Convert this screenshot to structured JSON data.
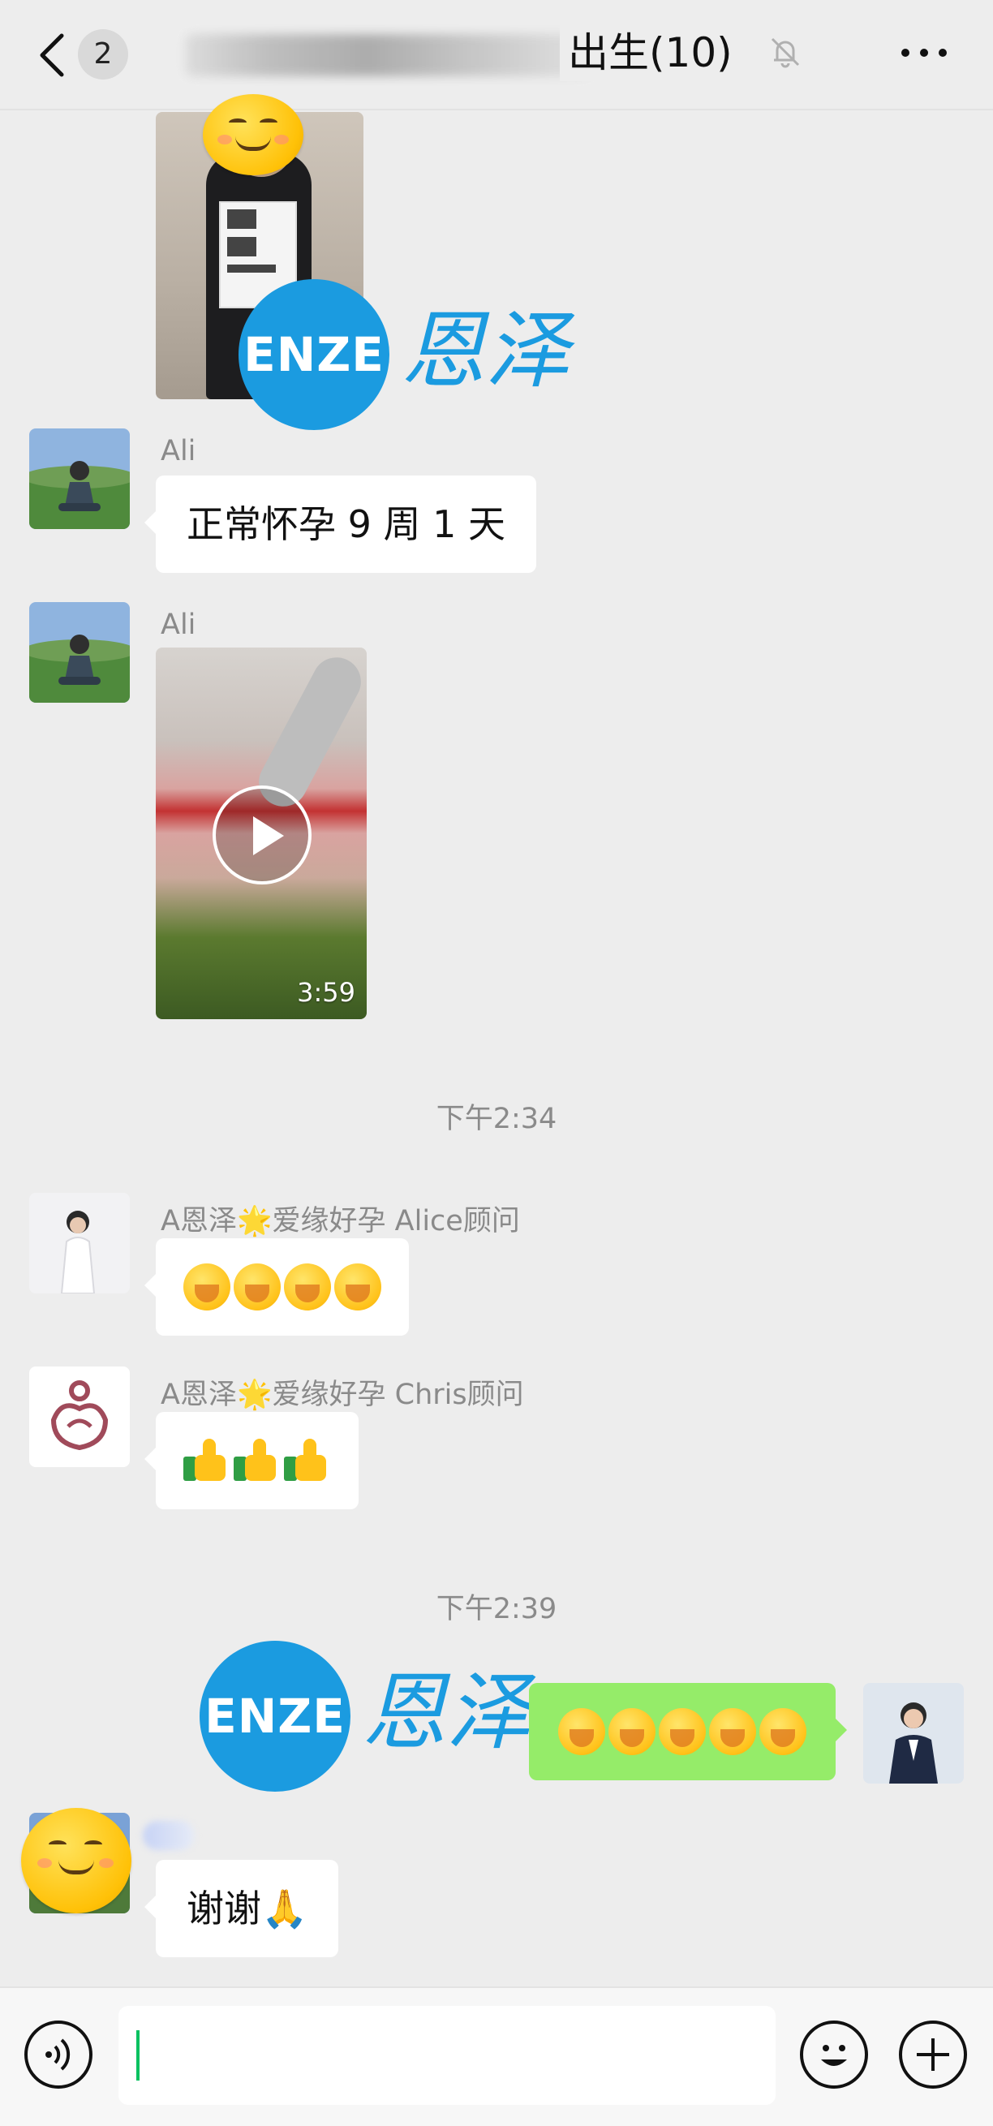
{
  "header": {
    "back_label": "<",
    "unread_count": "2",
    "title": "出生(10)",
    "mute_icon": "bell-off-icon",
    "more_icon": "more-dots-icon"
  },
  "messages": {
    "ali_name_1": "Ali",
    "ali_text": "正常怀孕 9 周 1 天",
    "ali_name_2": "Ali",
    "video_duration": "3:59",
    "time_1": "下午2:34",
    "alice_name": "A恩泽🌟爱缘好孕 Alice顾问",
    "chris_name": "A恩泽🌟爱缘好孕 Chris顾问",
    "time_2": "下午2:39",
    "last_text": "谢谢🙏"
  },
  "logos": {
    "enze_en": "ENZE",
    "enze_cn": "恩泽"
  },
  "input": {
    "value": "",
    "voice_icon": "voice-icon",
    "emoji_icon": "emoji-icon",
    "plus_icon": "plus-icon"
  },
  "colors": {
    "accent_green": "#95ec69",
    "brand_blue": "#1b9be0",
    "caret_green": "#07c160"
  }
}
